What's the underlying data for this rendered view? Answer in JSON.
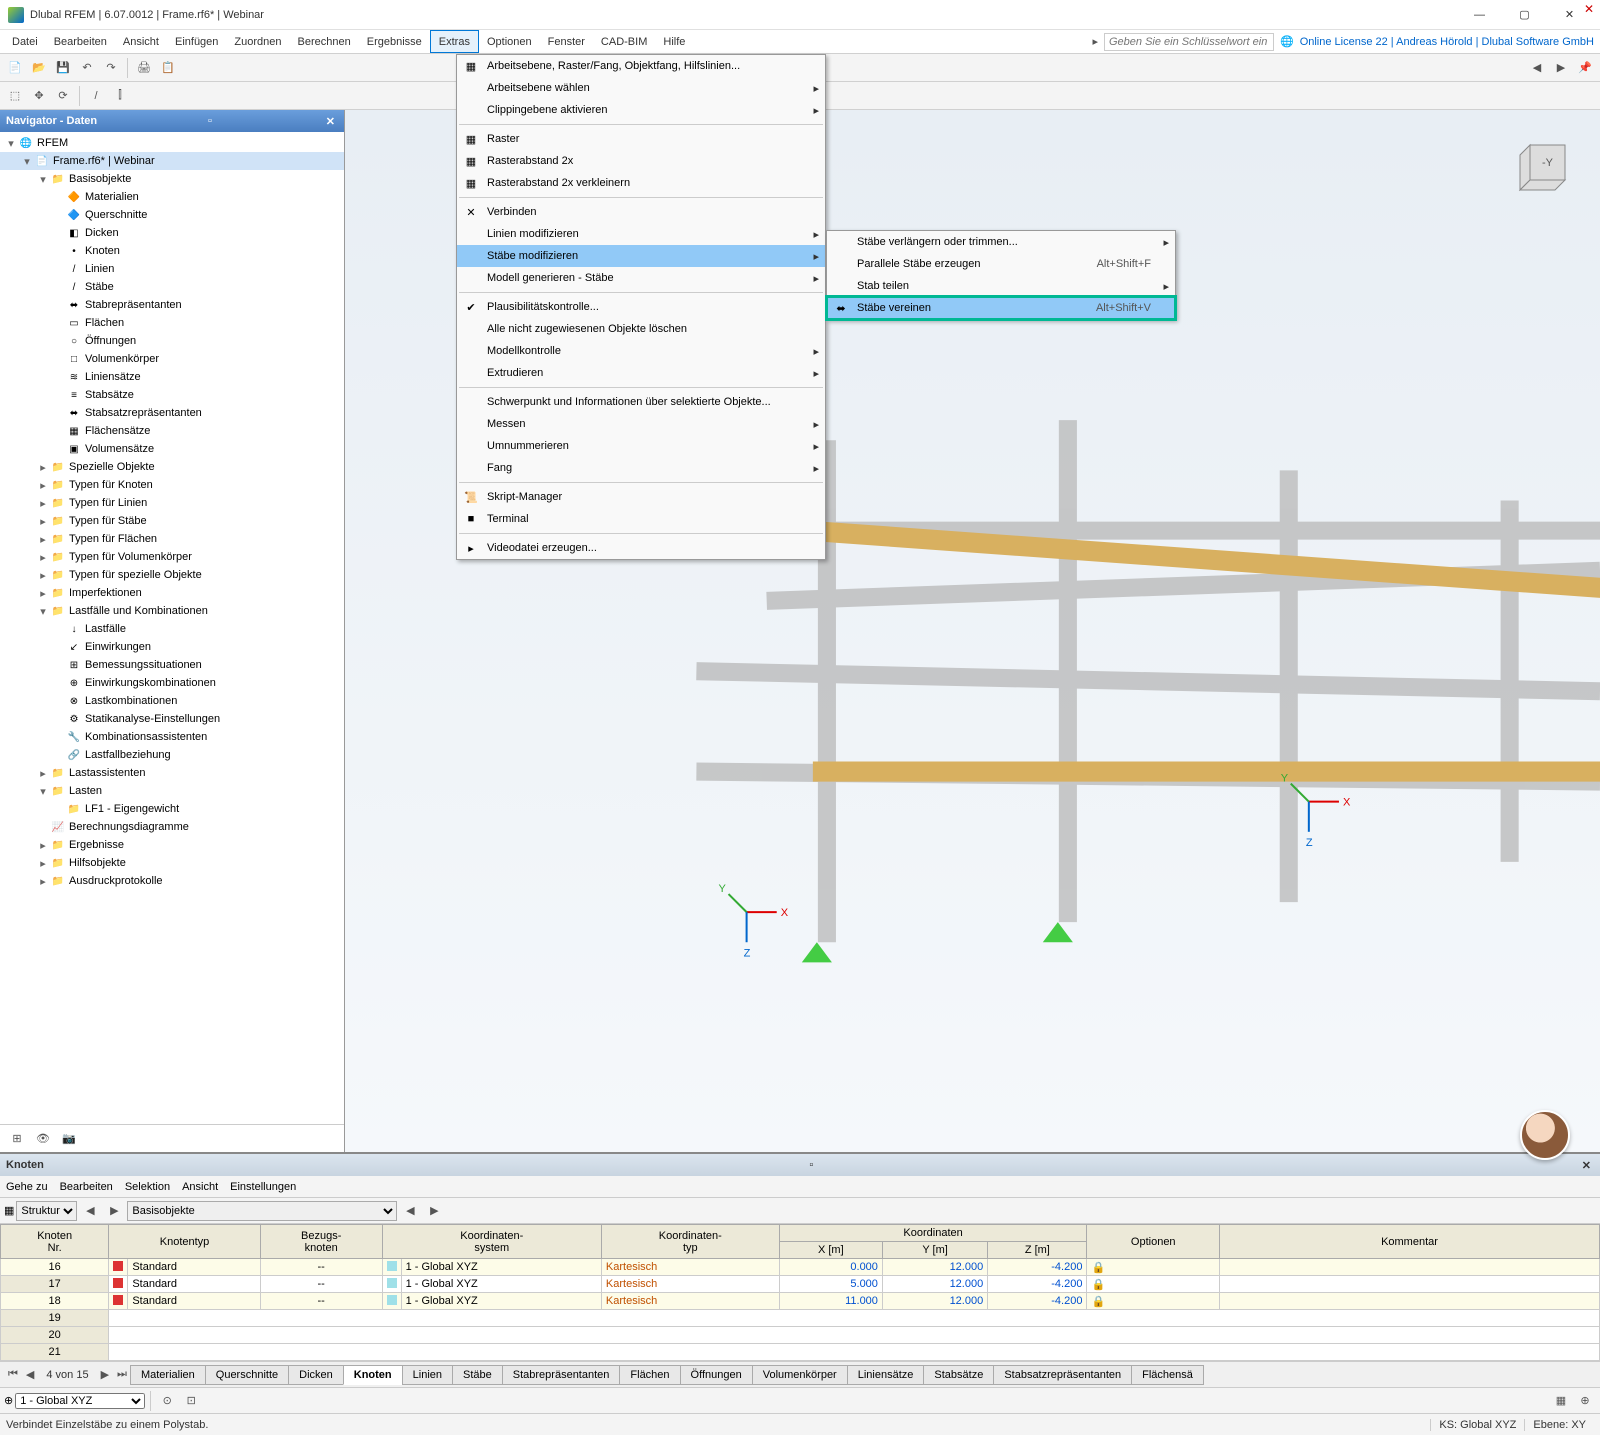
{
  "title": "Dlubal RFEM | 6.07.0012 | Frame.rf6* | Webinar",
  "menus": [
    "Datei",
    "Bearbeiten",
    "Ansicht",
    "Einfügen",
    "Zuordnen",
    "Berechnen",
    "Ergebnisse",
    "Extras",
    "Optionen",
    "Fenster",
    "CAD-BIM",
    "Hilfe"
  ],
  "active_menu": 7,
  "search_placeholder": "Geben Sie ein Schlüsselwort ein (Al...",
  "license": "Online License 22 | Andreas Hörold | Dlubal Software GmbH",
  "nav_title": "Navigator - Daten",
  "tree": [
    {
      "d": 0,
      "e": "▾",
      "i": "🌐",
      "t": "RFEM"
    },
    {
      "d": 1,
      "e": "▾",
      "i": "📄",
      "t": "Frame.rf6* | Webinar",
      "sel": true
    },
    {
      "d": 2,
      "e": "▾",
      "i": "📁",
      "t": "Basisobjekte"
    },
    {
      "d": 3,
      "e": "",
      "i": "🔶",
      "t": "Materialien"
    },
    {
      "d": 3,
      "e": "",
      "i": "🔷",
      "t": "Querschnitte"
    },
    {
      "d": 3,
      "e": "",
      "i": "◧",
      "t": "Dicken"
    },
    {
      "d": 3,
      "e": "",
      "i": "•",
      "t": "Knoten"
    },
    {
      "d": 3,
      "e": "",
      "i": "/",
      "t": "Linien"
    },
    {
      "d": 3,
      "e": "",
      "i": "/",
      "t": "Stäbe"
    },
    {
      "d": 3,
      "e": "",
      "i": "⬌",
      "t": "Stabrepräsentanten"
    },
    {
      "d": 3,
      "e": "",
      "i": "▭",
      "t": "Flächen"
    },
    {
      "d": 3,
      "e": "",
      "i": "○",
      "t": "Öffnungen"
    },
    {
      "d": 3,
      "e": "",
      "i": "□",
      "t": "Volumenkörper"
    },
    {
      "d": 3,
      "e": "",
      "i": "≋",
      "t": "Liniensätze"
    },
    {
      "d": 3,
      "e": "",
      "i": "≡",
      "t": "Stabsätze"
    },
    {
      "d": 3,
      "e": "",
      "i": "⬌",
      "t": "Stabsatzrepräsentanten"
    },
    {
      "d": 3,
      "e": "",
      "i": "▦",
      "t": "Flächensätze"
    },
    {
      "d": 3,
      "e": "",
      "i": "▣",
      "t": "Volumensätze"
    },
    {
      "d": 2,
      "e": "▸",
      "i": "📁",
      "t": "Spezielle Objekte"
    },
    {
      "d": 2,
      "e": "▸",
      "i": "📁",
      "t": "Typen für Knoten"
    },
    {
      "d": 2,
      "e": "▸",
      "i": "📁",
      "t": "Typen für Linien"
    },
    {
      "d": 2,
      "e": "▸",
      "i": "📁",
      "t": "Typen für Stäbe"
    },
    {
      "d": 2,
      "e": "▸",
      "i": "📁",
      "t": "Typen für Flächen"
    },
    {
      "d": 2,
      "e": "▸",
      "i": "📁",
      "t": "Typen für Volumenkörper"
    },
    {
      "d": 2,
      "e": "▸",
      "i": "📁",
      "t": "Typen für spezielle Objekte"
    },
    {
      "d": 2,
      "e": "▸",
      "i": "📁",
      "t": "Imperfektionen"
    },
    {
      "d": 2,
      "e": "▾",
      "i": "📁",
      "t": "Lastfälle und Kombinationen"
    },
    {
      "d": 3,
      "e": "",
      "i": "↓",
      "t": "Lastfälle"
    },
    {
      "d": 3,
      "e": "",
      "i": "↙",
      "t": "Einwirkungen"
    },
    {
      "d": 3,
      "e": "",
      "i": "⊞",
      "t": "Bemessungssituationen"
    },
    {
      "d": 3,
      "e": "",
      "i": "⊕",
      "t": "Einwirkungskombinationen"
    },
    {
      "d": 3,
      "e": "",
      "i": "⊗",
      "t": "Lastkombinationen"
    },
    {
      "d": 3,
      "e": "",
      "i": "⚙",
      "t": "Statikanalyse-Einstellungen"
    },
    {
      "d": 3,
      "e": "",
      "i": "🔧",
      "t": "Kombinationsassistenten"
    },
    {
      "d": 3,
      "e": "",
      "i": "🔗",
      "t": "Lastfallbeziehung"
    },
    {
      "d": 2,
      "e": "▸",
      "i": "📁",
      "t": "Lastassistenten"
    },
    {
      "d": 2,
      "e": "▾",
      "i": "📁",
      "t": "Lasten"
    },
    {
      "d": 3,
      "e": "",
      "i": "📁",
      "t": "LF1 - Eigengewicht"
    },
    {
      "d": 2,
      "e": "",
      "i": "📈",
      "t": "Berechnungsdiagramme"
    },
    {
      "d": 2,
      "e": "▸",
      "i": "📁",
      "t": "Ergebnisse"
    },
    {
      "d": 2,
      "e": "▸",
      "i": "📁",
      "t": "Hilfsobjekte"
    },
    {
      "d": 2,
      "e": "▸",
      "i": "📁",
      "t": "Ausdruckprotokolle"
    }
  ],
  "dropdown": [
    {
      "t": "Arbeitsebene, Raster/Fang, Objektfang, Hilfslinien...",
      "i": "▦"
    },
    {
      "t": "Arbeitsebene wählen",
      "sub": true
    },
    {
      "t": "Clippingebene aktivieren",
      "sub": true
    },
    {
      "sep": true
    },
    {
      "t": "Raster",
      "i": "▦"
    },
    {
      "t": "Rasterabstand 2x",
      "i": "▦"
    },
    {
      "t": "Rasterabstand 2x verkleinern",
      "i": "▦"
    },
    {
      "sep": true
    },
    {
      "t": "Verbinden",
      "i": "✕"
    },
    {
      "t": "Linien modifizieren",
      "sub": true
    },
    {
      "t": "Stäbe modifizieren",
      "sub": true,
      "hl": true
    },
    {
      "t": "Modell generieren - Stäbe",
      "sub": true
    },
    {
      "sep": true
    },
    {
      "t": "Plausibilitätskontrolle...",
      "i": "✔"
    },
    {
      "t": "Alle nicht zugewiesenen Objekte löschen"
    },
    {
      "t": "Modellkontrolle",
      "sub": true
    },
    {
      "t": "Extrudieren",
      "sub": true
    },
    {
      "sep": true
    },
    {
      "t": "Schwerpunkt und Informationen über selektierte Objekte..."
    },
    {
      "t": "Messen",
      "sub": true
    },
    {
      "t": "Umnummerieren",
      "sub": true
    },
    {
      "t": "Fang",
      "sub": true
    },
    {
      "sep": true
    },
    {
      "t": "Skript-Manager",
      "i": "📜"
    },
    {
      "t": "Terminal",
      "i": "■"
    },
    {
      "sep": true
    },
    {
      "t": "Videodatei erzeugen...",
      "i": "▸"
    }
  ],
  "submenu": [
    {
      "t": "Stäbe verlängern oder trimmen...",
      "sub": true
    },
    {
      "t": "Parallele Stäbe erzeugen",
      "sc": "Alt+Shift+F"
    },
    {
      "t": "Stab teilen",
      "sub": true
    },
    {
      "t": "Stäbe vereinen",
      "sc": "Alt+Shift+V",
      "hl": true,
      "teal": true,
      "i": "⬌"
    }
  ],
  "bp_title": "Knoten",
  "bp_menus": [
    "Gehe zu",
    "Bearbeiten",
    "Selektion",
    "Ansicht",
    "Einstellungen"
  ],
  "bp_sel1": "Struktur",
  "bp_sel2": "Basisobjekte",
  "grid_head1": [
    "Knoten\nNr.",
    "Knotentyp",
    "Bezugs-\nknoten",
    "Koordinaten-\nsystem",
    "Koordinaten-\ntyp",
    "Koordinaten",
    "Optionen",
    "Kommentar"
  ],
  "grid_head2": [
    "X [m]",
    "Y [m]",
    "Z [m]"
  ],
  "rows": [
    {
      "n": "16",
      "t": "Standard",
      "b": "--",
      "s": "1 - Global XYZ",
      "k": "Kartesisch",
      "x": "0.000",
      "y": "12.000",
      "z": "-4.200"
    },
    {
      "n": "17",
      "t": "Standard",
      "b": "--",
      "s": "1 - Global XYZ",
      "k": "Kartesisch",
      "x": "5.000",
      "y": "12.000",
      "z": "-4.200"
    },
    {
      "n": "18",
      "t": "Standard",
      "b": "--",
      "s": "1 - Global XYZ",
      "k": "Kartesisch",
      "x": "11.000",
      "y": "12.000",
      "z": "-4.200"
    }
  ],
  "empty_rows": [
    "19",
    "20",
    "21"
  ],
  "pager": "4 von 15",
  "tabs": [
    "Materialien",
    "Querschnitte",
    "Dicken",
    "Knoten",
    "Linien",
    "Stäbe",
    "Stabrepräsentanten",
    "Flächen",
    "Öffnungen",
    "Volumenkörper",
    "Liniensätze",
    "Stabsätze",
    "Stabsatzrepräsentanten",
    "Flächensä"
  ],
  "active_tab": 3,
  "status_left": "Verbindet Einzelstäbe zu einem Polystab.",
  "status_ks": "KS: Global XYZ",
  "status_ebene": "Ebene: XY",
  "coord_sel": "1 - Global XYZ"
}
